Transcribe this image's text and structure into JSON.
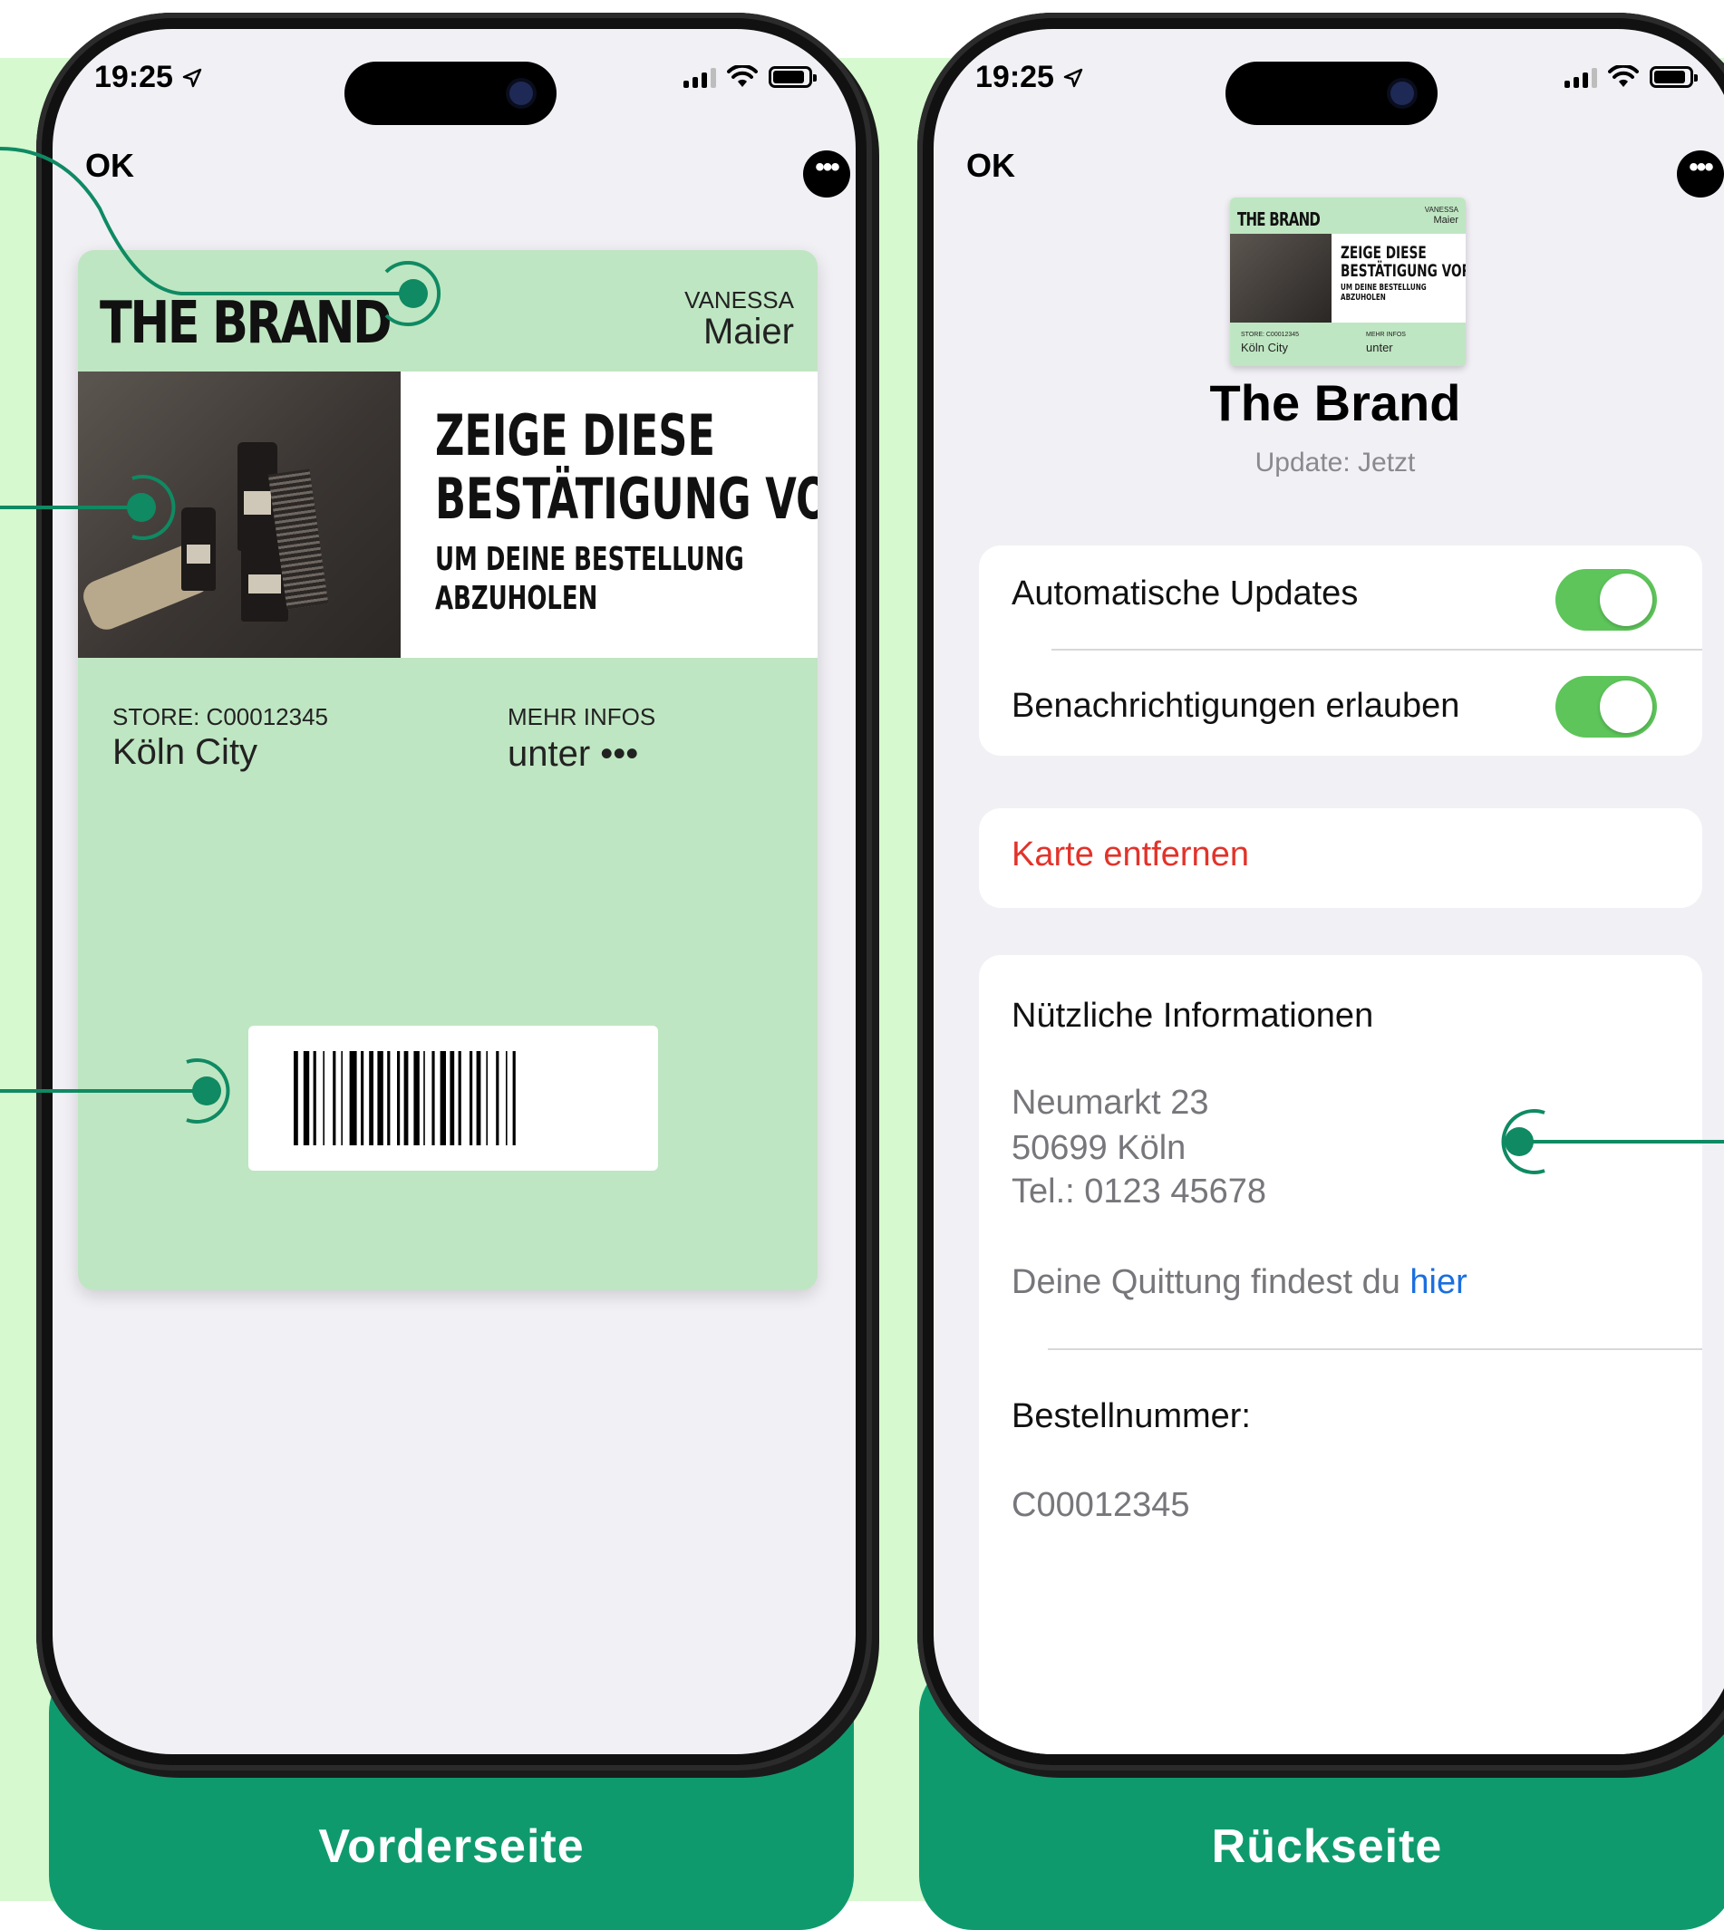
{
  "colors": {
    "background": "#d6f9cf",
    "accent": "#0f9a6e",
    "pass_green": "#bfe6c2",
    "toggle_on": "#5dc55a",
    "destructive": "#e2332a",
    "link": "#1a6fe0"
  },
  "labels": {
    "front": "Vorderseite",
    "back": "Rückseite"
  },
  "front_phone": {
    "status_time": "19:25",
    "nav_ok": "OK",
    "more_icon": "ellipsis-circle-icon",
    "pass": {
      "brand_logo": "THE BRAND",
      "name_label": "VANESSA",
      "name_value": "Maier",
      "headline_1": "ZEIGE DIESE",
      "headline_2": "BESTÄTIGUNG VOR",
      "subline_1": "UM DEINE BESTELLUNG",
      "subline_2": "ABZUHOLEN",
      "store_label": "STORE: C00012345",
      "store_value": "Köln City",
      "info_label": "MEHR INFOS",
      "info_value": "unter •••"
    }
  },
  "back_phone": {
    "status_time": "19:25",
    "nav_ok": "OK",
    "thumbnail": {
      "brand_logo": "THE BRAND",
      "name_label": "VANESSA",
      "name_value": "Maier",
      "headline_1": "ZEIGE DIESE",
      "headline_2": "BESTÄTIGUNG VOR",
      "subline_1": "UM DEINE BESTELLUNG",
      "subline_2": "ABZUHOLEN",
      "store_label": "STORE: C00012345",
      "store_value": "Köln City",
      "info_label": "MEHR INFOS",
      "info_value": "unter"
    },
    "title": "The Brand",
    "subtitle": "Update: Jetzt",
    "settings": {
      "auto_updates": "Automatische Updates",
      "notifications": "Benachrichtigungen erlauben"
    },
    "remove_card": "Karte entfernen",
    "info": {
      "heading": "Nützliche Informationen",
      "address_1": "Neumarkt 23",
      "address_2": "50699 Köln",
      "phone": "Tel.: 0123 45678",
      "receipt_text": "Deine Quittung findest du ",
      "receipt_link": "hier",
      "order_heading": "Bestellnummer:",
      "order_number": "C00012345"
    }
  }
}
